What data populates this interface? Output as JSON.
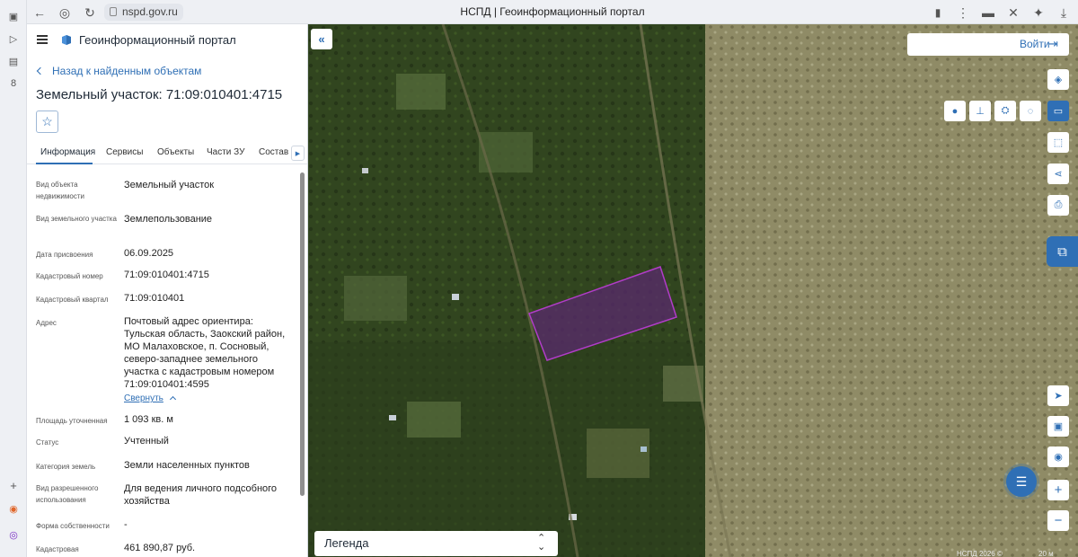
{
  "browser": {
    "url": "nspd.gov.ru",
    "page_title": "НСПД | Геоинформационный портал"
  },
  "panel": {
    "app_title": "Геоинформационный портал",
    "back_label": "Назад к найденным объектам",
    "heading": "Земельный участок: 71:09:010401:4715",
    "tabs": [
      "Информация",
      "Сервисы",
      "Объекты",
      "Части ЗУ",
      "Состав"
    ],
    "attributes": [
      {
        "label": "Вид объекта недвижимости",
        "value": "Земельный участок"
      },
      {
        "label": "Вид земельного участка",
        "value": "Землепользование"
      },
      {
        "label": "Дата присвоения",
        "value": "06.09.2025"
      },
      {
        "label": "Кадастровый номер",
        "value": "71:09:010401:4715"
      },
      {
        "label": "Кадастровый квартал",
        "value": "71:09:010401"
      },
      {
        "label": "Адрес",
        "value": "Почтовый адрес ориентира:\nТульская область, Заокский район,\nМО Малаховское, п. Сосновый,\nсеверо-западнее земельного\nучастка с кадастровым номером\n71:09:010401:4595"
      },
      {
        "label": "Площадь уточненная",
        "value": "1 093 кв. м"
      },
      {
        "label": "Статус",
        "value": "Учтенный"
      },
      {
        "label": "Категория земель",
        "value": "Земли населенных пунктов"
      },
      {
        "label": "Вид разрешенного использования",
        "value": "Для ведения личного подсобного\nхозяйства"
      },
      {
        "label": "Форма собственности",
        "value": "-"
      },
      {
        "label": "Кадастровая",
        "value": "461 890,87 руб."
      }
    ],
    "collapse_label": "Свернуть"
  },
  "map": {
    "login_label": "Войти",
    "legend_label": "Легенда",
    "attribution": "НСПД 2026 ©",
    "scale": "20 м",
    "parcel_color": "#b13cc8",
    "accent_color": "#2f6fb5"
  }
}
